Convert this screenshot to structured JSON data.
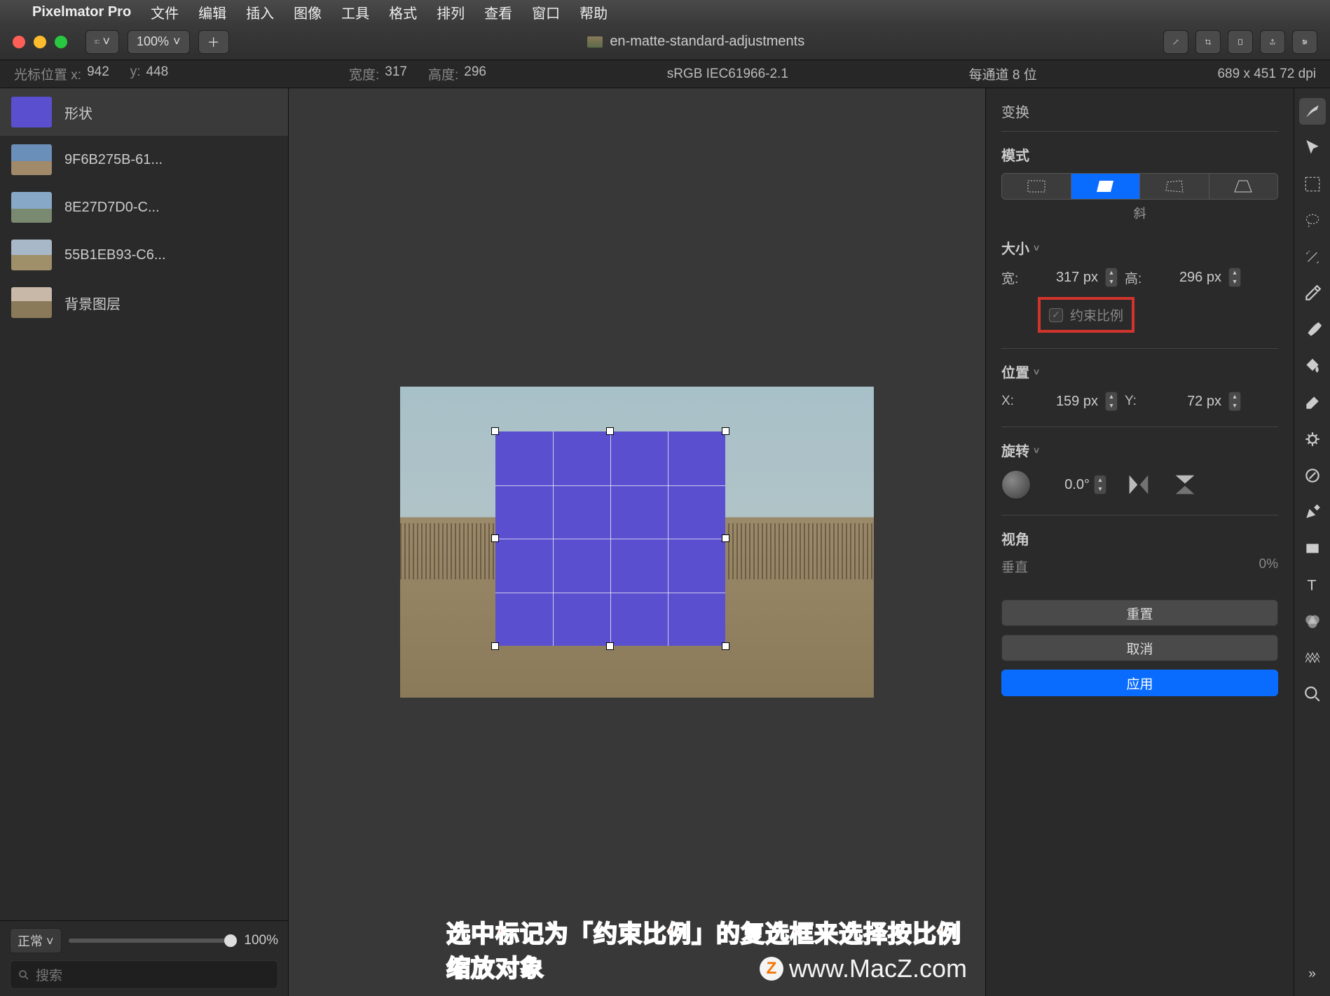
{
  "menubar": {
    "app": "Pixelmator Pro",
    "items": [
      "文件",
      "编辑",
      "插入",
      "图像",
      "工具",
      "格式",
      "排列",
      "查看",
      "窗口",
      "帮助"
    ]
  },
  "toolbar": {
    "zoom": "100%",
    "doc_title": "en-matte-standard-adjustments"
  },
  "infobar": {
    "cursor_label": "光标位置 x:",
    "cursor_x": "942",
    "cursor_y_label": "y:",
    "cursor_y": "448",
    "width_label": "宽度:",
    "width": "317",
    "height_label": "高度:",
    "height": "296",
    "color_profile": "sRGB IEC61966-2.1",
    "bit_depth": "每通道 8 位",
    "canvas_info": "689 x 451 72 dpi"
  },
  "layers": {
    "items": [
      {
        "name": "形状",
        "thumb": "shape"
      },
      {
        "name": "9F6B275B-61...",
        "thumb": "img1"
      },
      {
        "name": "8E27D7D0-C...",
        "thumb": "img2"
      },
      {
        "name": "55B1EB93-C6...",
        "thumb": "img3"
      },
      {
        "name": "背景图层",
        "thumb": "img4"
      }
    ],
    "blend": "正常",
    "opacity": "100%",
    "search_placeholder": "搜索"
  },
  "inspector": {
    "title": "变换",
    "mode_label": "模式",
    "mode_caption": "斜",
    "size_label": "大小",
    "width_label": "宽:",
    "width_value": "317 px",
    "height_label": "高:",
    "height_value": "296 px",
    "constrain_label": "约束比例",
    "position_label": "位置",
    "x_label": "X:",
    "x_value": "159 px",
    "y_label": "Y:",
    "y_value": "72 px",
    "rotate_label": "旋转",
    "angle_value": "0.0°",
    "perspective_label": "视角",
    "perspective_axis": "垂直",
    "perspective_value": "0%",
    "reset_btn": "重置",
    "cancel_btn": "取消",
    "apply_btn": "应用"
  },
  "tools": [
    "style",
    "arrow",
    "marquee",
    "lasso",
    "wand",
    "eyedropper",
    "brush",
    "bucket",
    "eraser",
    "repair",
    "shape",
    "pen",
    "rect",
    "text",
    "color",
    "fx",
    "zoom"
  ],
  "annotation": "选中标记为「约束比例」的复选框来选择按比例缩放对象",
  "watermark": "www.MacZ.com"
}
